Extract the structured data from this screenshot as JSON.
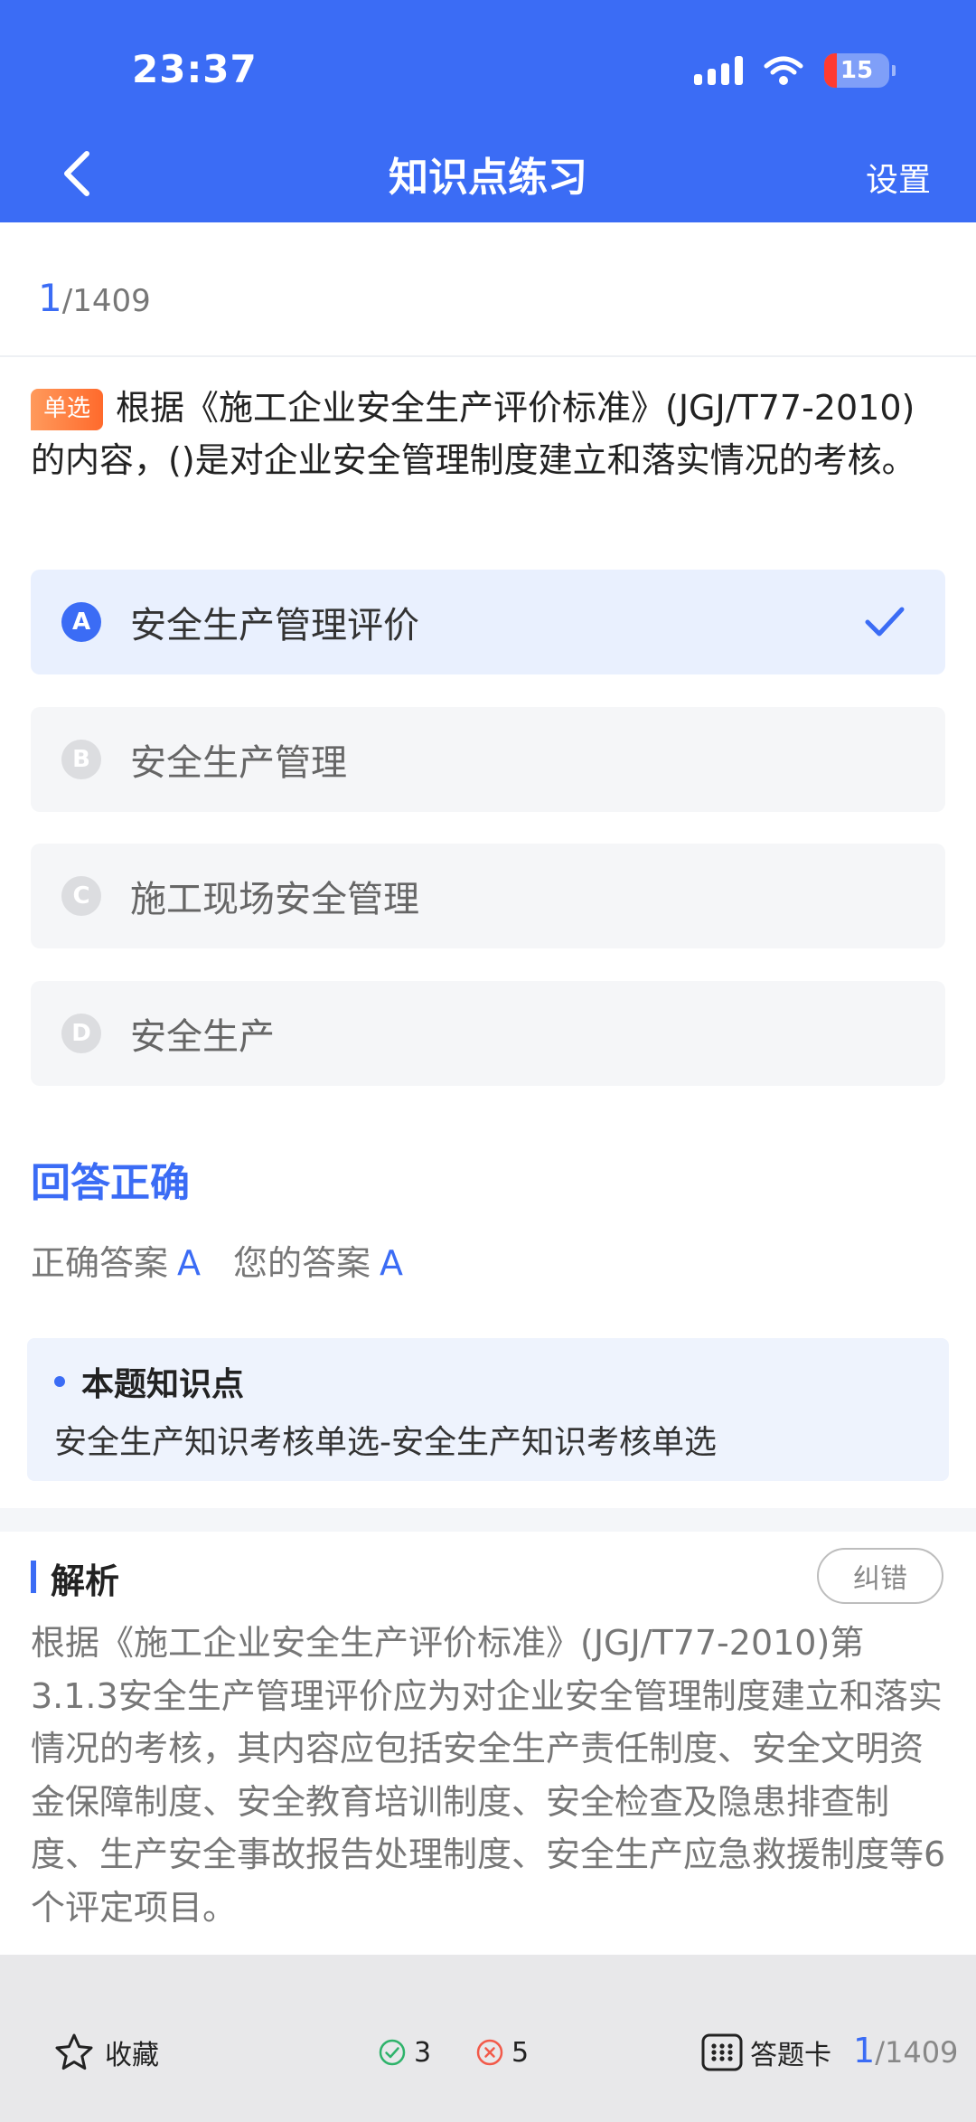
{
  "status": {
    "time": "23:37",
    "battery": "15"
  },
  "nav": {
    "title": "知识点练习",
    "settings": "设置"
  },
  "progress": {
    "current": "1",
    "total": "/1409"
  },
  "question": {
    "type_tag": "单选",
    "text": "根据《施工企业安全生产评价标准》(JGJ/T77-2010)的内容，()是对企业安全管理制度建立和落实情况的考核。"
  },
  "options": [
    {
      "letter": "A",
      "text": "安全生产管理评价",
      "selected": true
    },
    {
      "letter": "B",
      "text": "安全生产管理",
      "selected": false
    },
    {
      "letter": "C",
      "text": "施工现场安全管理",
      "selected": false
    },
    {
      "letter": "D",
      "text": "安全生产",
      "selected": false
    }
  ],
  "result": {
    "title": "回答正确",
    "correct_label": "正确答案",
    "correct_value": "A",
    "yours_label": "您的答案",
    "yours_value": "A"
  },
  "knowledge": {
    "title": "本题知识点",
    "text": "安全生产知识考核单选-安全生产知识考核单选"
  },
  "analysis": {
    "title": "解析",
    "report_label": "纠错",
    "text": "根据《施工企业安全生产评价标准》(JGJ/T77-2010)第3.1.3安全生产管理评价应为对企业安全管理制度建立和落实情况的考核，其内容应包括安全生产责任制度、安全文明资金保障制度、安全教育培训制度、安全检查及隐患排查制度、生产安全事故报告处理制度、安全生产应急救援制度等6个评定项目。"
  },
  "bottom": {
    "favorite": "收藏",
    "correct_count": "3",
    "wrong_count": "5",
    "answer_card": "答题卡",
    "current": "1",
    "total": "/1409"
  },
  "colors": {
    "primary": "#3b6cf5",
    "tag_orange": "#ff7a3c",
    "correct_green": "#2fb36b",
    "wrong_red": "#f25a4a"
  }
}
